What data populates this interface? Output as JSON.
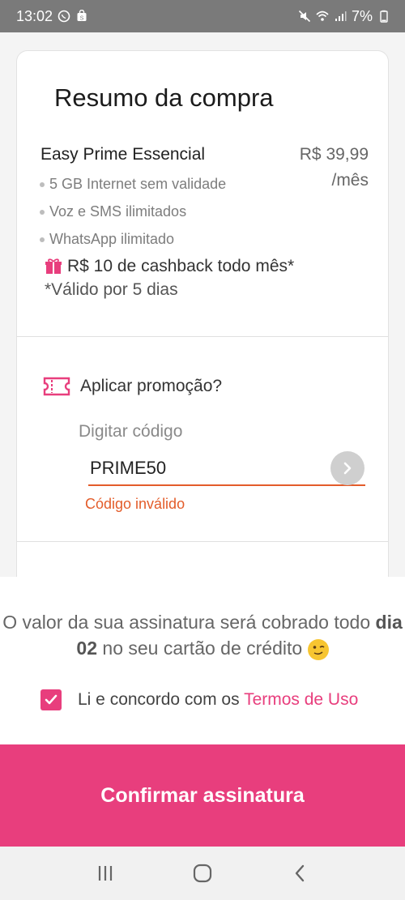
{
  "status_bar": {
    "time": "13:02",
    "battery": "7%",
    "icons": [
      "whatsapp-icon",
      "shop-icon",
      "mute-icon",
      "wifi-icon",
      "signal-icon"
    ]
  },
  "summary": {
    "title": "Resumo da compra",
    "plan_name": "Easy Prime Essencial",
    "price": "R$ 39,99",
    "period": "/mês",
    "features": [
      "5 GB Internet sem validade",
      "Voz e SMS ilimitados",
      "WhatsApp ilimitado"
    ],
    "cashback": "R$ 10 de cashback todo mês*",
    "validity": "*Válido por 5 dias"
  },
  "promo": {
    "label": "Aplicar promoção?",
    "code_label": "Digitar código",
    "code_value": "PRIME50",
    "error": "Código inválido"
  },
  "billing": {
    "text_before": "O valor da sua assinatura será cobrado todo ",
    "text_bold": "dia 02",
    "text_after": " no seu cartão de crédito"
  },
  "terms": {
    "checked": true,
    "text": "Li e concordo com os ",
    "link": "Termos de Uso"
  },
  "confirm_label": "Confirmar assinatura",
  "colors": {
    "accent": "#e83e7d",
    "error": "#e35c2a",
    "status_bar": "#7a7a7a"
  }
}
